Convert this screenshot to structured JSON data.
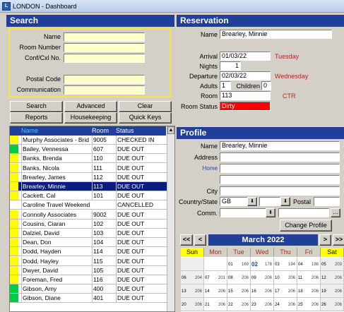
{
  "window": {
    "title": "LONDON - Dashboard",
    "icon": "hotel-app-icon"
  },
  "search": {
    "header": "Search",
    "fields": [
      {
        "label": "Name",
        "value": ""
      },
      {
        "label": "Room Number",
        "value": ""
      },
      {
        "label": "Conf/Cxl No.",
        "value": ""
      },
      {
        "label": "Postal Code",
        "value": ""
      },
      {
        "label": "Communication",
        "value": ""
      }
    ],
    "buttons": [
      "Search",
      "Advanced",
      "Clear",
      "Reports",
      "Housekeeping",
      "Quick Keys"
    ]
  },
  "results": {
    "columns": [
      "Name",
      "Room",
      "Status"
    ],
    "rows": [
      {
        "name": "Murphy Associates - Brid",
        "room": "9005",
        "status": "CHECKED IN",
        "color": "#ffff00"
      },
      {
        "name": "Bailey, Vennessa",
        "room": "607",
        "status": "DUE OUT",
        "color": "#00cc44"
      },
      {
        "name": "Banks, Brenda",
        "room": "110",
        "status": "DUE OUT",
        "color": "#ffff00"
      },
      {
        "name": "Banks, Nicola",
        "room": "111",
        "status": "DUE OUT",
        "color": "#ffff00"
      },
      {
        "name": "Brearley, James",
        "room": "112",
        "status": "DUE OUT",
        "color": "#ffff00"
      },
      {
        "name": "Brearley, Minnie",
        "room": "113",
        "status": "DUE OUT",
        "color": "#ffff00",
        "selected": true
      },
      {
        "name": "Cackett, Cal",
        "room": "101",
        "status": "DUE OUT",
        "color": "#ffff00"
      },
      {
        "name": "Caroline Travel Weekend",
        "room": "",
        "status": "CANCELLED",
        "color": ""
      },
      {
        "name": "Connolly Associates",
        "room": "9002",
        "status": "DUE OUT",
        "color": "#ffff00"
      },
      {
        "name": "Cousins, Ciaran",
        "room": "102",
        "status": "DUE OUT",
        "color": "#ffff00"
      },
      {
        "name": "Dalziel, David",
        "room": "103",
        "status": "DUE OUT",
        "color": "#ffff00"
      },
      {
        "name": "Dean, Don",
        "room": "104",
        "status": "DUE OUT",
        "color": "#ffff00"
      },
      {
        "name": "Dodd, Hayden",
        "room": "114",
        "status": "DUE OUT",
        "color": "#ffff00"
      },
      {
        "name": "Dodd, Hayley",
        "room": "115",
        "status": "DUE OUT",
        "color": "#ffff00"
      },
      {
        "name": "Dwyer, David",
        "room": "105",
        "status": "DUE OUT",
        "color": "#ffff00"
      },
      {
        "name": "Foreman, Fred",
        "room": "116",
        "status": "DUE OUT",
        "color": "#ffff00"
      },
      {
        "name": "Gibson, Amy",
        "room": "400",
        "status": "DUE OUT",
        "color": "#00cc44"
      },
      {
        "name": "Gibson, Diane",
        "room": "401",
        "status": "DUE OUT",
        "color": "#00cc44"
      }
    ]
  },
  "reservation": {
    "header": "Reservation",
    "name_label": "Name",
    "name": "Brearley, Minnie",
    "arrival_label": "Arrival",
    "arrival": "01/03/22",
    "arrival_day": "Tuesday",
    "nights_label": "Nights",
    "nights": "1",
    "departure_label": "Departure",
    "departure": "02/03/22",
    "departure_day": "Wednesday",
    "adults_label": "Adults",
    "adults": "1",
    "children_label": "Children",
    "children": "0",
    "room_label": "Room",
    "room": "113",
    "room_type": "CTR",
    "room_status_label": "Room Status",
    "room_status": "Dirty"
  },
  "profile": {
    "header": "Profile",
    "name_label": "Name",
    "name": "Brearley, Minnie",
    "address_label": "Address",
    "home_label": "Home",
    "city_label": "City",
    "country_state_label": "Country/State",
    "country": "GB",
    "postal_label": "Postal",
    "comm_label": "Comm.",
    "change_button": "Change Profile"
  },
  "calendar": {
    "month": "March 2022",
    "nav": [
      "<<",
      "<",
      ">",
      ">>"
    ],
    "days": [
      "Sun",
      "Mon",
      "Tue",
      "Wed",
      "Thu",
      "Fri",
      "Sat"
    ],
    "weeks": [
      [
        {
          "d": "",
          "n": ""
        },
        {
          "d": "",
          "n": ""
        },
        {
          "d": "01",
          "n": "169"
        },
        {
          "d": "02",
          "n": "178"
        },
        {
          "d": "03",
          "n": "194"
        },
        {
          "d": "04",
          "n": "198"
        },
        {
          "d": "05",
          "n": "203"
        }
      ],
      [
        {
          "d": "06",
          "n": "204"
        },
        {
          "d": "07",
          "n": "201"
        },
        {
          "d": "08",
          "n": "206"
        },
        {
          "d": "09",
          "n": "206"
        },
        {
          "d": "10",
          "n": "206"
        },
        {
          "d": "11",
          "n": "206"
        },
        {
          "d": "12",
          "n": "206"
        }
      ],
      [
        {
          "d": "13",
          "n": "206"
        },
        {
          "d": "14",
          "n": "206"
        },
        {
          "d": "15",
          "n": "206"
        },
        {
          "d": "16",
          "n": "206"
        },
        {
          "d": "17",
          "n": "206"
        },
        {
          "d": "18",
          "n": "206"
        },
        {
          "d": "19",
          "n": "206"
        }
      ],
      [
        {
          "d": "20",
          "n": "206"
        },
        {
          "d": "21",
          "n": "206"
        },
        {
          "d": "22",
          "n": "206"
        },
        {
          "d": "23",
          "n": "206"
        },
        {
          "d": "24",
          "n": "206"
        },
        {
          "d": "25",
          "n": "206"
        },
        {
          "d": "26",
          "n": "206"
        }
      ]
    ]
  }
}
